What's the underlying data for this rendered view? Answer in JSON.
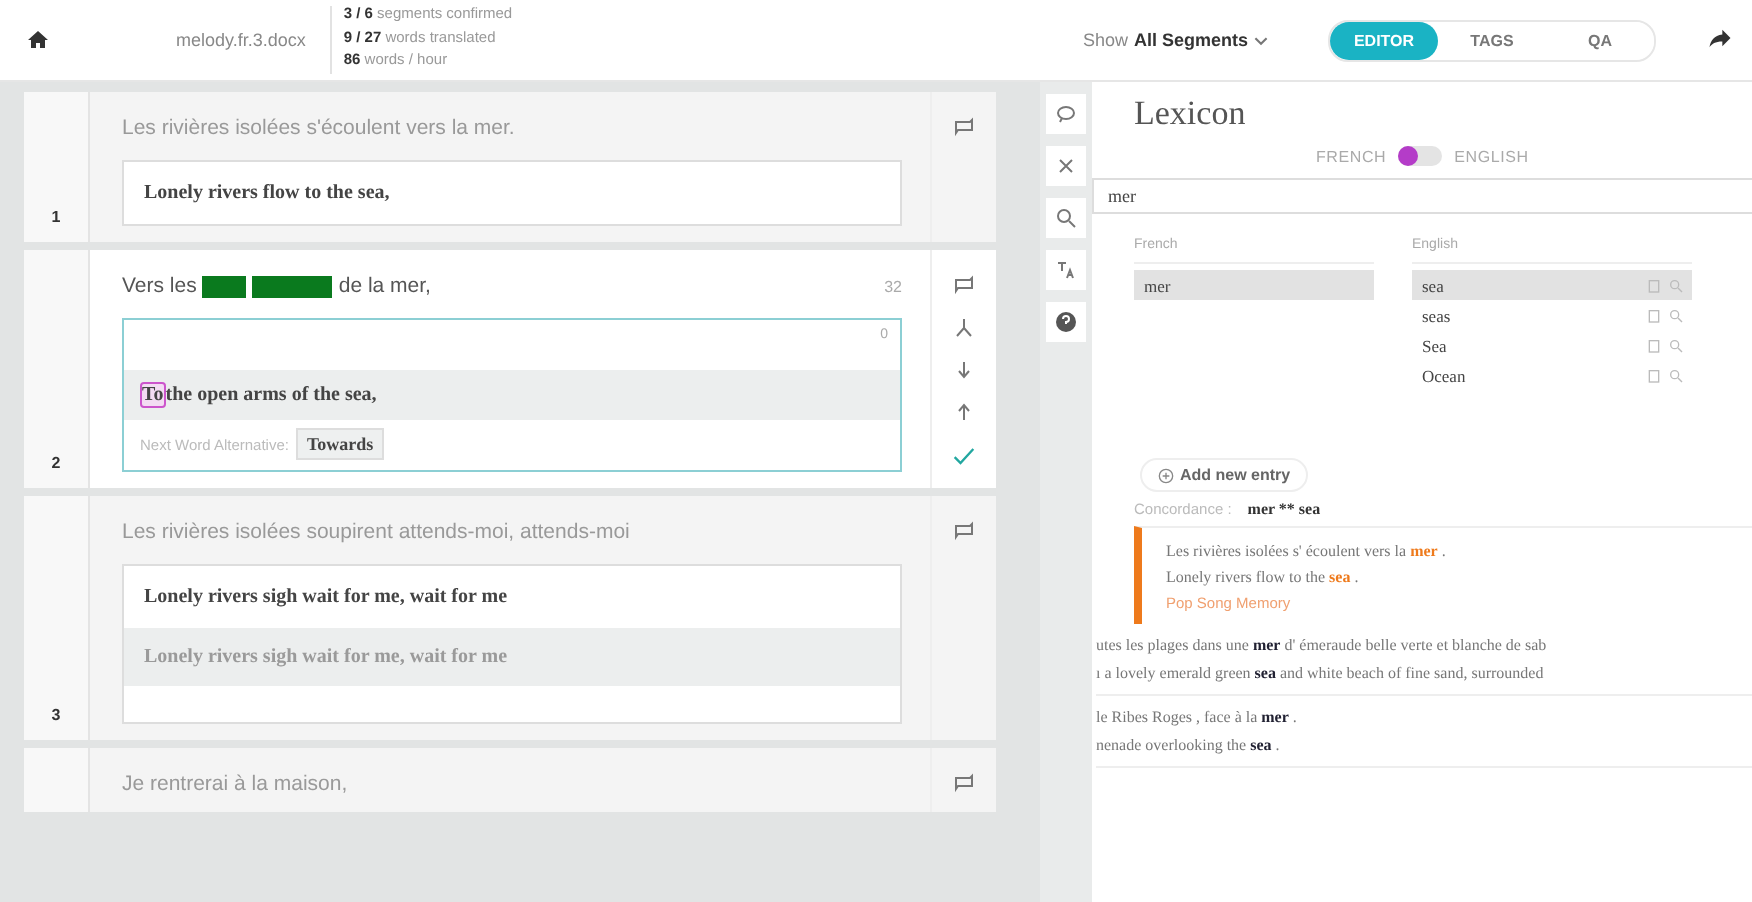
{
  "header": {
    "file": "melody.fr.3.docx",
    "stats": [
      "**3 / 6** segments confirmed",
      "**9 / 27** words translated",
      "**86** words / hour"
    ],
    "filter": {
      "label": "Show",
      "value": "All Segments"
    },
    "tabs": [
      {
        "label": "EDITOR",
        "selected": true
      },
      {
        "label": "TAGS",
        "selected": false
      },
      {
        "label": "QA",
        "selected": false
      }
    ]
  },
  "segments": [
    {
      "number": "1",
      "active": false,
      "source": [
        {
          "kind": "text",
          "text": "Les rivières isolées s'écoulent vers la mer."
        }
      ],
      "target": "Lonely rivers flow to the sea,"
    },
    {
      "number": "2",
      "active": true,
      "source": [
        {
          "kind": "text",
          "text": "Vers les"
        },
        {
          "kind": "highlight"
        },
        {
          "kind": "highlight"
        },
        {
          "kind": "text",
          "text": "de la mer,"
        }
      ],
      "source_count": "32",
      "target_count": "0",
      "cursor_word": "To",
      "target": "the open arms of the sea,",
      "alternative_label": "Next Word Alternative:",
      "alternative": "Towards"
    },
    {
      "number": "3",
      "active": false,
      "source": [
        {
          "kind": "text",
          "text": "Les rivières isolées soupirent attends-moi, attends-moi"
        }
      ],
      "target": "Lonely rivers sigh wait for me, wait for me",
      "suggestion": "Lonely rivers sigh wait for me, wait for me"
    },
    {
      "active": false,
      "source": [
        {
          "kind": "text",
          "text": "Je rentrerai à la maison,"
        }
      ]
    }
  ],
  "lexicon": {
    "title": "Lexicon",
    "toggle": {
      "left": "FRENCH",
      "right": "ENGLISH",
      "on": false
    },
    "search": "mer",
    "french": {
      "heading": "French",
      "items": [
        {
          "text": "mer",
          "selected": true
        }
      ]
    },
    "english": {
      "heading": "English",
      "items": [
        {
          "text": "sea",
          "selected": true
        },
        {
          "text": "seas",
          "selected": false
        },
        {
          "text": "Sea",
          "selected": false
        },
        {
          "text": "Ocean",
          "selected": false
        }
      ]
    },
    "add_entry": "Add new entry",
    "concordance_label": "Concordance :",
    "concordance_pair": "mer ** sea",
    "matches": [
      {
        "source": "Les rivières isolées s' écoulent vers la **mer** .",
        "target": "Lonely rivers flow to the **sea** .",
        "origin": "Pop Song Memory",
        "highlighted": true
      },
      {
        "source": "utes les plages dans une **mer** d' émeraude belle verte et blanche de sab",
        "target": "ı a lovely emerald green **sea** and white beach of fine sand, surrounded",
        "highlighted": false
      },
      {
        "source": "le Ribes Roges , face à la **mer** .",
        "target": "nenade overlooking the **sea** .",
        "highlighted": false
      }
    ]
  }
}
